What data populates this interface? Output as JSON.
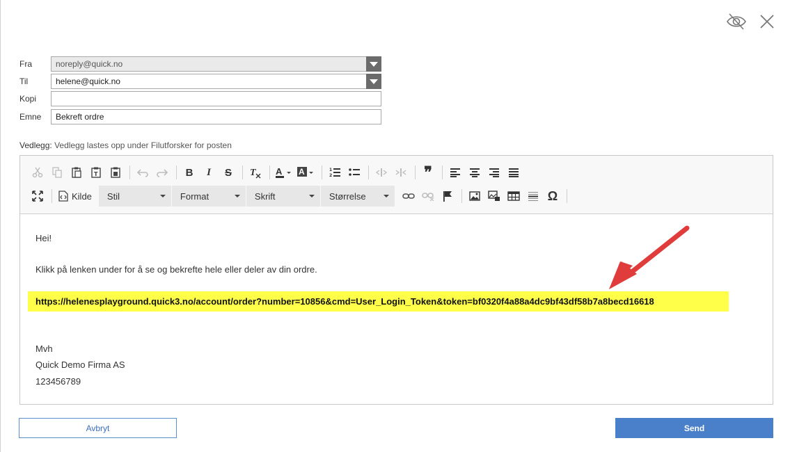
{
  "fields": {
    "from": {
      "label": "Fra",
      "value": "noreply@quick.no"
    },
    "to": {
      "label": "Til",
      "value": "helene@quick.no"
    },
    "cc": {
      "label": "Kopi",
      "value": ""
    },
    "subject": {
      "label": "Emne",
      "value": "Bekreft ordre"
    }
  },
  "attachment": {
    "label": "Vedlegg:",
    "text": "Vedlegg lastes opp under Filutforsker for posten"
  },
  "toolbar": {
    "source_label": "Kilde",
    "style_label": "Stil",
    "format_label": "Format",
    "font_label": "Skrift",
    "size_label": "Størrelse",
    "bold": "B",
    "italic": "I",
    "strike": "S",
    "omega": "Ω",
    "quote": "❞"
  },
  "body": {
    "greeting": "Hei!",
    "intro": "Klikk på lenken under for å se og bekrefte hele eller deler av din ordre.",
    "link": "https://helenesplayground.quick3.no/account/order?number=10856&cmd=User_Login_Token&token=bf0320f4a88a4dc9bf43df58b7a8becd16618",
    "sign_off": "Mvh",
    "company": "Quick Demo Firma AS",
    "phone": "123456789"
  },
  "buttons": {
    "cancel": "Avbryt",
    "send": "Send"
  },
  "colors": {
    "accent": "#4a7fc9",
    "highlight": "#ffff4a",
    "arrow": "#e03c3c"
  }
}
